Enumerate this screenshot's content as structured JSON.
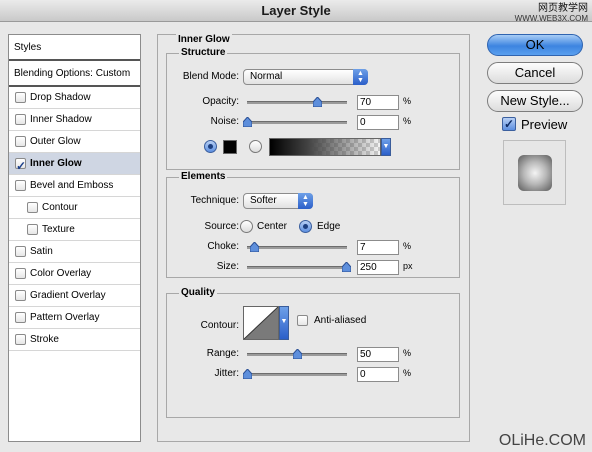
{
  "window": {
    "title": "Layer Style"
  },
  "watermark": {
    "top_line1": "网页教学网",
    "top_line2": "WWW.WEB3X.COM",
    "bottom": "OLiHe.COM"
  },
  "sidebar": {
    "header": "Styles",
    "blending": "Blending Options: Custom",
    "items": [
      {
        "label": "Drop Shadow",
        "checked": false
      },
      {
        "label": "Inner Shadow",
        "checked": false
      },
      {
        "label": "Outer Glow",
        "checked": false
      },
      {
        "label": "Inner Glow",
        "checked": true,
        "selected": true
      },
      {
        "label": "Bevel and Emboss",
        "checked": false
      },
      {
        "label": "Contour",
        "checked": false,
        "indent": true
      },
      {
        "label": "Texture",
        "checked": false,
        "indent": true
      },
      {
        "label": "Satin",
        "checked": false
      },
      {
        "label": "Color Overlay",
        "checked": false
      },
      {
        "label": "Gradient Overlay",
        "checked": false
      },
      {
        "label": "Pattern Overlay",
        "checked": false
      },
      {
        "label": "Stroke",
        "checked": false
      }
    ]
  },
  "panel": {
    "title": "Inner Glow",
    "structure": {
      "title": "Structure",
      "blend_mode_label": "Blend Mode:",
      "blend_mode_value": "Normal",
      "opacity_label": "Opacity:",
      "opacity_value": "70",
      "opacity_unit": "%",
      "noise_label": "Noise:",
      "noise_value": "0",
      "noise_unit": "%",
      "color_swatch": "#000000"
    },
    "elements": {
      "title": "Elements",
      "technique_label": "Technique:",
      "technique_value": "Softer",
      "source_label": "Source:",
      "source_center": "Center",
      "source_edge": "Edge",
      "choke_label": "Choke:",
      "choke_value": "7",
      "choke_unit": "%",
      "size_label": "Size:",
      "size_value": "250",
      "size_unit": "px"
    },
    "quality": {
      "title": "Quality",
      "contour_label": "Contour:",
      "anti_aliased_label": "Anti-aliased",
      "range_label": "Range:",
      "range_value": "50",
      "range_unit": "%",
      "jitter_label": "Jitter:",
      "jitter_value": "0",
      "jitter_unit": "%"
    }
  },
  "buttons": {
    "ok": "OK",
    "cancel": "Cancel",
    "new_style": "New Style..."
  },
  "preview": {
    "label": "Preview",
    "checked": true
  }
}
